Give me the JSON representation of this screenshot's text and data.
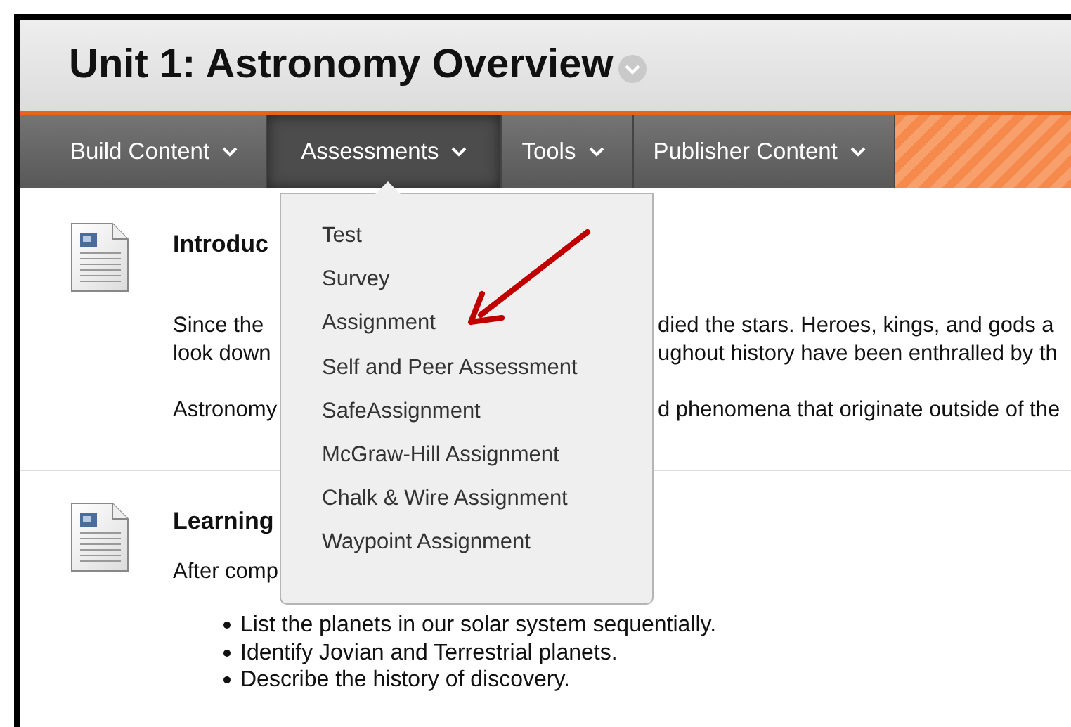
{
  "page_title": "Unit 1: Astronomy Overview",
  "menu_bar": [
    {
      "label": "Build Content",
      "selected": false
    },
    {
      "label": "Assessments",
      "selected": true
    },
    {
      "label": "Tools",
      "selected": false
    },
    {
      "label": "Publisher Content",
      "selected": false
    }
  ],
  "dropdown": {
    "items": [
      "Test",
      "Survey",
      "Assignment",
      "Self and Peer Assessment",
      "SafeAssignment",
      "McGraw-Hill Assignment",
      "Chalk & Wire Assignment",
      "Waypoint Assignment"
    ]
  },
  "content_items": [
    {
      "title": "Introduc",
      "paragraphs": [
        [
          {
            "left": "Since the",
            "right": "died the stars. Heroes, kings, and gods a"
          },
          {
            "left": "look down",
            "right": "ughout history have been enthralled by th"
          }
        ],
        [
          {
            "left": "Astronomy",
            "right": "d phenomena that originate outside of the"
          }
        ]
      ]
    },
    {
      "title": "Learning",
      "paragraphs": [
        [
          {
            "left": "After comp"
          }
        ]
      ],
      "bullets": [
        "List the planets in our solar system sequentially.",
        "Identify Jovian and Terrestrial planets.",
        "Describe the history of discovery."
      ]
    }
  ]
}
